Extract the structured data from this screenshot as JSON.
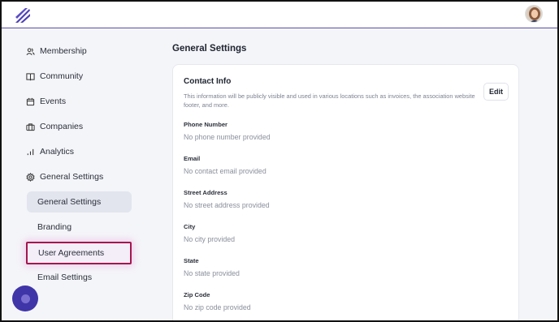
{
  "header": {
    "logo_icon": "feather-logo-icon",
    "avatar_icon": "user-avatar",
    "accent": "#5b4fa8"
  },
  "sidebar": {
    "items": [
      {
        "label": "Membership",
        "icon": "users-icon"
      },
      {
        "label": "Community",
        "icon": "book-icon"
      },
      {
        "label": "Events",
        "icon": "calendar-icon"
      },
      {
        "label": "Companies",
        "icon": "briefcase-icon"
      },
      {
        "label": "Analytics",
        "icon": "bar-chart-icon"
      },
      {
        "label": "General Settings",
        "icon": "gear-icon"
      }
    ],
    "sub_items": [
      {
        "label": "General Settings",
        "active": true
      },
      {
        "label": "Branding"
      },
      {
        "label": "User Agreements",
        "highlighted": true
      },
      {
        "label": "Email Settings"
      }
    ]
  },
  "main": {
    "title": "General Settings",
    "card": {
      "title": "Contact Info",
      "description": "This information will be publicly visible and used in various locations such as invoices, the association website footer, and more.",
      "edit_label": "Edit",
      "fields": [
        {
          "label": "Phone Number",
          "value": "No phone number provided"
        },
        {
          "label": "Email",
          "value": "No contact email provided"
        },
        {
          "label": "Street Address",
          "value": "No street address provided"
        },
        {
          "label": "City",
          "value": "No city provided"
        },
        {
          "label": "State",
          "value": "No state provided"
        },
        {
          "label": "Zip Code",
          "value": "No zip code provided"
        }
      ]
    }
  },
  "colors": {
    "active_bg": "#e2e5ee",
    "highlight_border": "#a3174f",
    "fab": "#3f35a8"
  }
}
